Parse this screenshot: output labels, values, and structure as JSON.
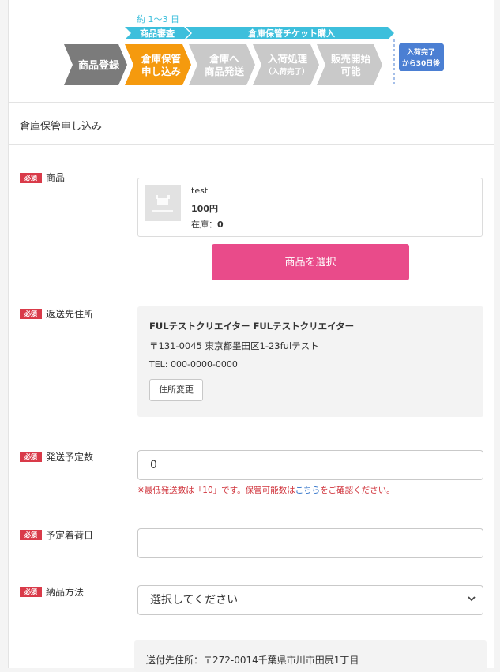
{
  "flow": {
    "duration": "約 1〜3 日",
    "review": "商品審査",
    "ticket": "倉庫保管チケット購入",
    "steps": [
      {
        "line1": "商品登録",
        "line2": ""
      },
      {
        "line1": "倉庫保管",
        "line2": "申し込み"
      },
      {
        "line1": "倉庫へ",
        "line2": "商品発送"
      },
      {
        "line1": "入荷処理",
        "line2": "（入荷完了）"
      },
      {
        "line1": "販売開始",
        "line2": "可能"
      }
    ],
    "badge_line1": "入荷完了",
    "badge_line2": "から30日後",
    "colors": {
      "done": "#7b7b7b",
      "active": "#f59a0e",
      "todo": "#c9c9c9",
      "cyan": "#3dbfdc",
      "badge": "#4b7fd3"
    }
  },
  "section_title": "倉庫保管申し込み",
  "required_label": "必須",
  "product": {
    "label": "商品",
    "name": "test",
    "price": "100円",
    "stock_label": "在庫：",
    "stock_value": "0",
    "select_button": "商品を選択"
  },
  "return_address": {
    "label": "返送先住所",
    "name": "FULテストクリエイター FULテストクリエイター",
    "address": "〒131-0045 東京都墨田区1-23fulテスト",
    "tel": "TEL: 000-0000-0000",
    "change_button": "住所変更"
  },
  "quantity": {
    "label": "発送予定数",
    "value": "0",
    "note_pre": "※最低発送数は「10」です。保管可能数は",
    "note_link": "こちら",
    "note_post": "をご確認ください。"
  },
  "arrival_date": {
    "label": "予定着荷日",
    "value": ""
  },
  "delivery": {
    "label": "納品方法",
    "placeholder": "選択してください"
  },
  "destination": {
    "text": "送付先住所：〒272-0014千葉県市川市田尻1丁目"
  },
  "accent": {
    "pink": "#e94b8a",
    "required": "#d93a49"
  }
}
